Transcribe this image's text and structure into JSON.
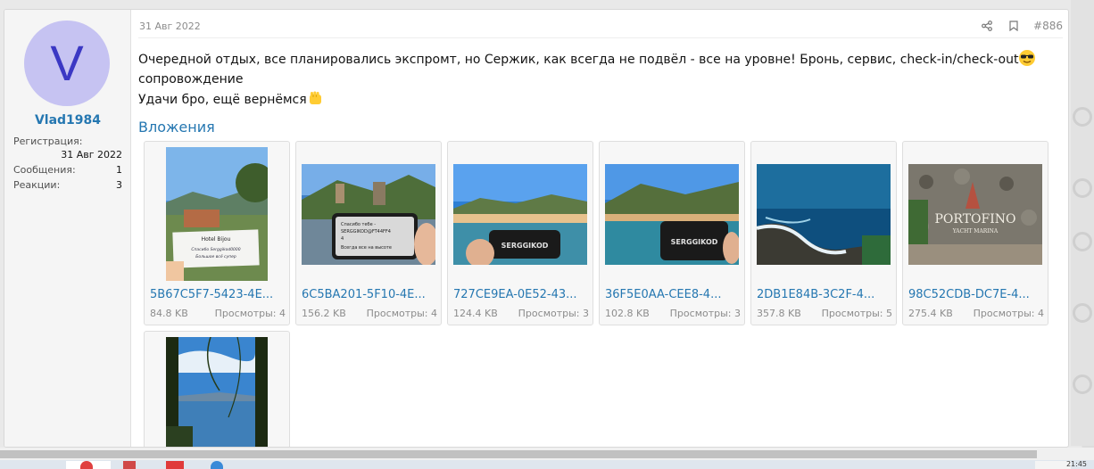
{
  "user": {
    "avatar_letter": "V",
    "name": "Vlad1984",
    "stats": [
      {
        "label": "Регистрация:",
        "value": "31 Авг 2022"
      },
      {
        "label": "Сообщения:",
        "value": "1"
      },
      {
        "label": "Реакции:",
        "value": "3"
      }
    ]
  },
  "post": {
    "date": "31 Авг 2022",
    "number": "#886",
    "line1": "Очередной отдых, все планировались экспромт, но Сержик, как всегда не подвёл - все на уровне! Бронь, сервис, check-in/check-out",
    "line2": "сопровождение",
    "line3": "Удачи бро, ещё вернёмся"
  },
  "attachments_title": "Вложения",
  "attachments": [
    {
      "name": "5B67C5F7-5423-4E...",
      "size": "84.8 KB",
      "views": "Просмотры: 4"
    },
    {
      "name": "6C5BA201-5F10-4E...",
      "size": "156.2 KB",
      "views": "Просмотры: 4"
    },
    {
      "name": "727CE9EA-0E52-43...",
      "size": "124.4 KB",
      "views": "Просмотры: 3"
    },
    {
      "name": "36F5E0AA-CEE8-4...",
      "size": "102.8 KB",
      "views": "Просмотры: 3"
    },
    {
      "name": "2DB1E84B-3C2F-4...",
      "size": "357.8 KB",
      "views": "Просмотры: 5"
    },
    {
      "name": "98C52CDB-DC7E-4...",
      "size": "275.4 KB",
      "views": "Просмотры: 4"
    },
    {
      "name": "",
      "size": "",
      "views": ""
    }
  ],
  "photo_text": {
    "note_title": "Hotel Bijou",
    "note_line1": "Спасибо Serggikod0000",
    "note_line2": "Большое всё супер",
    "phone1_line1": "Спасибо тебе -",
    "phone1_line2": "SERGGIKOD@FT44FF4",
    "phone1_line3": "4",
    "phone1_line4": "Всегда все на высоте",
    "phone_brand": "SERGGIKOD",
    "sign_line1": "PORTOFINO",
    "sign_line2": "YACHT MARINA"
  },
  "clock": "21:45",
  "colors": {
    "accent": "#2577b1",
    "avatar_bg": "#c6c3f2",
    "avatar_fg": "#3b38c4"
  },
  "icons": [
    "share-icon",
    "bookmark-icon",
    "sunglasses-emoji-icon",
    "fist-emoji-icon"
  ]
}
